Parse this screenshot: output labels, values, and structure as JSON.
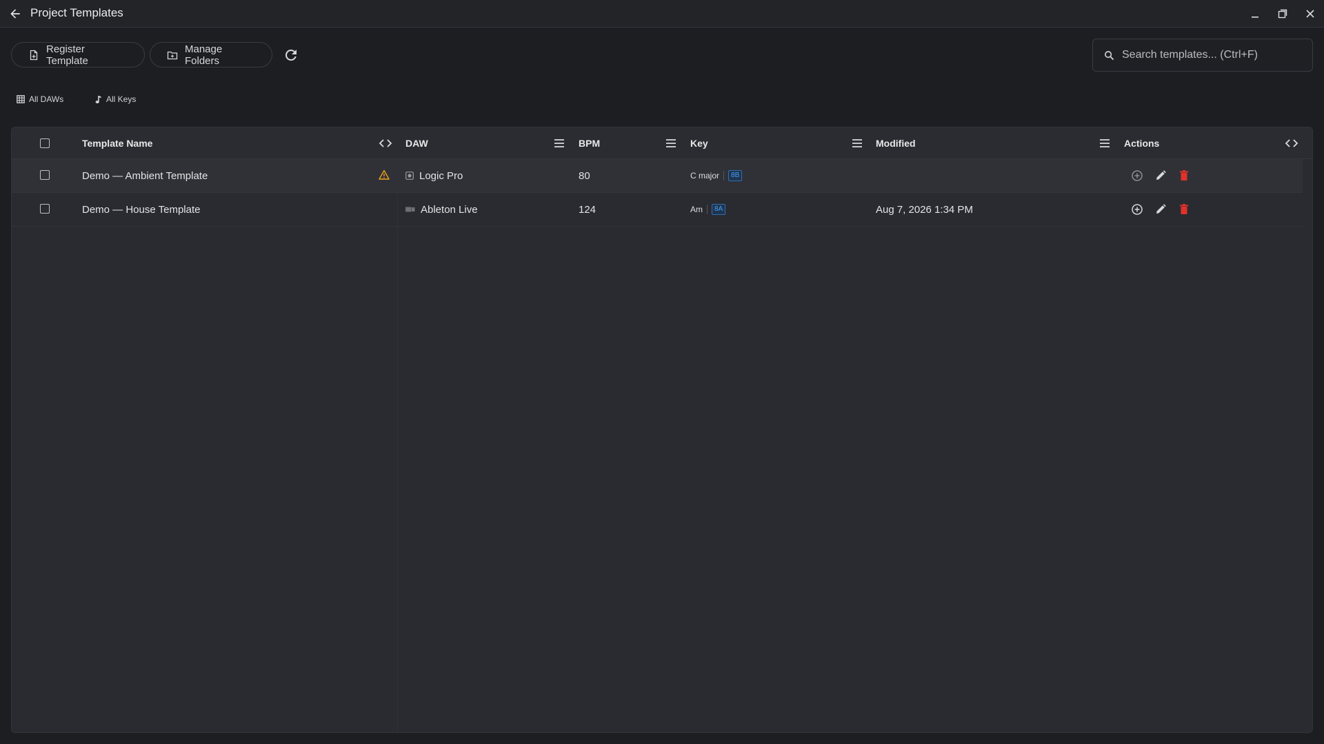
{
  "window": {
    "title": "Project Templates"
  },
  "toolbar": {
    "register_label": "Register Template",
    "manage_label": "Manage Folders"
  },
  "search": {
    "placeholder": "Search templates... (Ctrl+F)",
    "value": ""
  },
  "filters": {
    "daw_label": "All DAWs",
    "keys_label": "All Keys"
  },
  "table": {
    "columns": {
      "name": "Template Name",
      "daw": "DAW",
      "bpm": "BPM",
      "key": "Key",
      "modified": "Modified",
      "actions": "Actions"
    },
    "rows": [
      {
        "name": "Demo — Ambient Template",
        "warning": true,
        "daw": "Logic Pro",
        "daw_icon": "logic-pro-icon",
        "bpm": "80",
        "key": "C major",
        "camelot": "8B",
        "modified": ""
      },
      {
        "name": "Demo — House Template",
        "warning": false,
        "daw": "Ableton Live",
        "daw_icon": "ableton-live-icon",
        "bpm": "124",
        "key": "Am",
        "camelot": "8A",
        "modified": "Aug 7, 2026 1:34 PM"
      }
    ]
  },
  "colors": {
    "background": "#1d1e22",
    "panel": "#2a2b30",
    "accent_blue": "#4a9df0",
    "warning": "#f0a020",
    "delete": "#e0322c"
  }
}
